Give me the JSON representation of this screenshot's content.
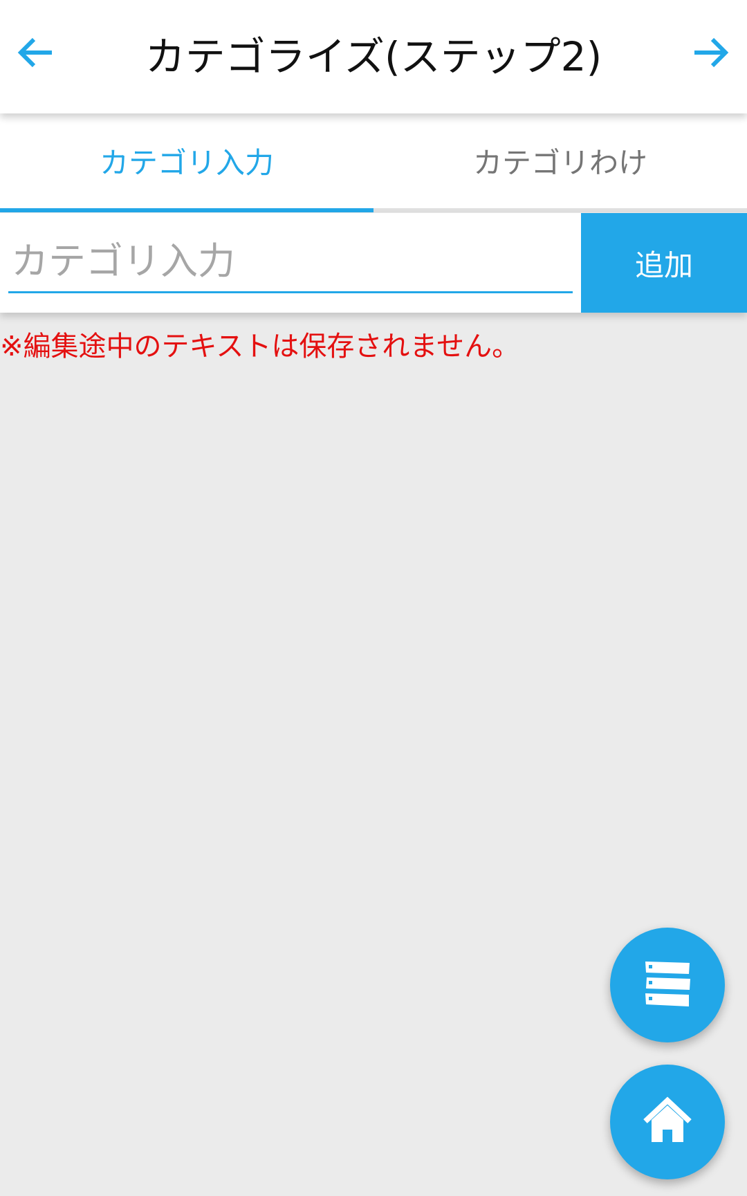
{
  "app_bar": {
    "title": "カテゴライズ(ステップ2)",
    "back_icon": "arrow-left-icon",
    "forward_icon": "arrow-right-icon"
  },
  "tabs": [
    {
      "label": "カテゴリ入力",
      "selected": true
    },
    {
      "label": "カテゴリわけ",
      "selected": false
    }
  ],
  "category_input": {
    "placeholder": "カテゴリ入力",
    "value": ""
  },
  "add_button": {
    "label": "追加"
  },
  "warning": {
    "text": "※編集途中のテキストは保存されません。"
  },
  "fabs": [
    {
      "icon": "category-list-icon"
    },
    {
      "icon": "home-icon"
    }
  ],
  "colors": {
    "accent": "#22a7e8",
    "warning": "#e41010",
    "inactive_tab": "#757575",
    "background": "#ebebeb"
  }
}
